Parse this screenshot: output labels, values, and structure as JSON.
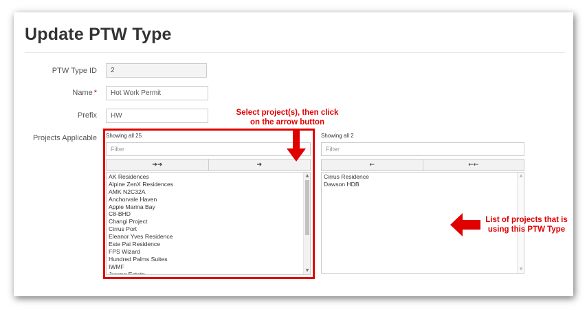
{
  "page": {
    "title": "Update PTW Type"
  },
  "form": {
    "type_id": {
      "label": "PTW Type ID",
      "value": "2"
    },
    "name": {
      "label": "Name",
      "required_mark": "*",
      "value": "Hot Work Permit"
    },
    "prefix": {
      "label": "Prefix",
      "value": "HW"
    },
    "projects": {
      "label": "Projects Applicable"
    }
  },
  "available": {
    "showing": "Showing all 25",
    "filter_placeholder": "Filter",
    "move_all_glyph": "➔➔",
    "move_selected_glyph": "➔",
    "items": [
      "AK Residences",
      "Alpine ZenX Residences",
      "AMK N2C32A",
      "Anchorvale Haven",
      "Apple Marina Bay",
      "C8-BHD",
      "Changi Project",
      "Cirrus Port",
      "Eleanor Yves Residence",
      "Este Pai Residence",
      "FPS Wizard",
      "Hundred Palms Suites",
      "IWMF",
      "Jurong Estate"
    ]
  },
  "selected": {
    "showing": "Showing all 2",
    "filter_placeholder": "Filter",
    "remove_selected_glyph": "←",
    "remove_all_glyph": "←←",
    "items": [
      "Cirrus Residence",
      "Dawson HDB"
    ]
  },
  "annotations": {
    "select_hint_line1": "Select project(s), then click",
    "select_hint_line2": "on the arrow button",
    "list_hint_line1": "List of projects that is",
    "list_hint_line2": "using this PTW Type"
  },
  "colors": {
    "annotation_red": "#e00000",
    "border": "#cccccc",
    "title_text": "#333333"
  },
  "icons": {
    "scroll_up": "▲",
    "scroll_down": "▼"
  }
}
